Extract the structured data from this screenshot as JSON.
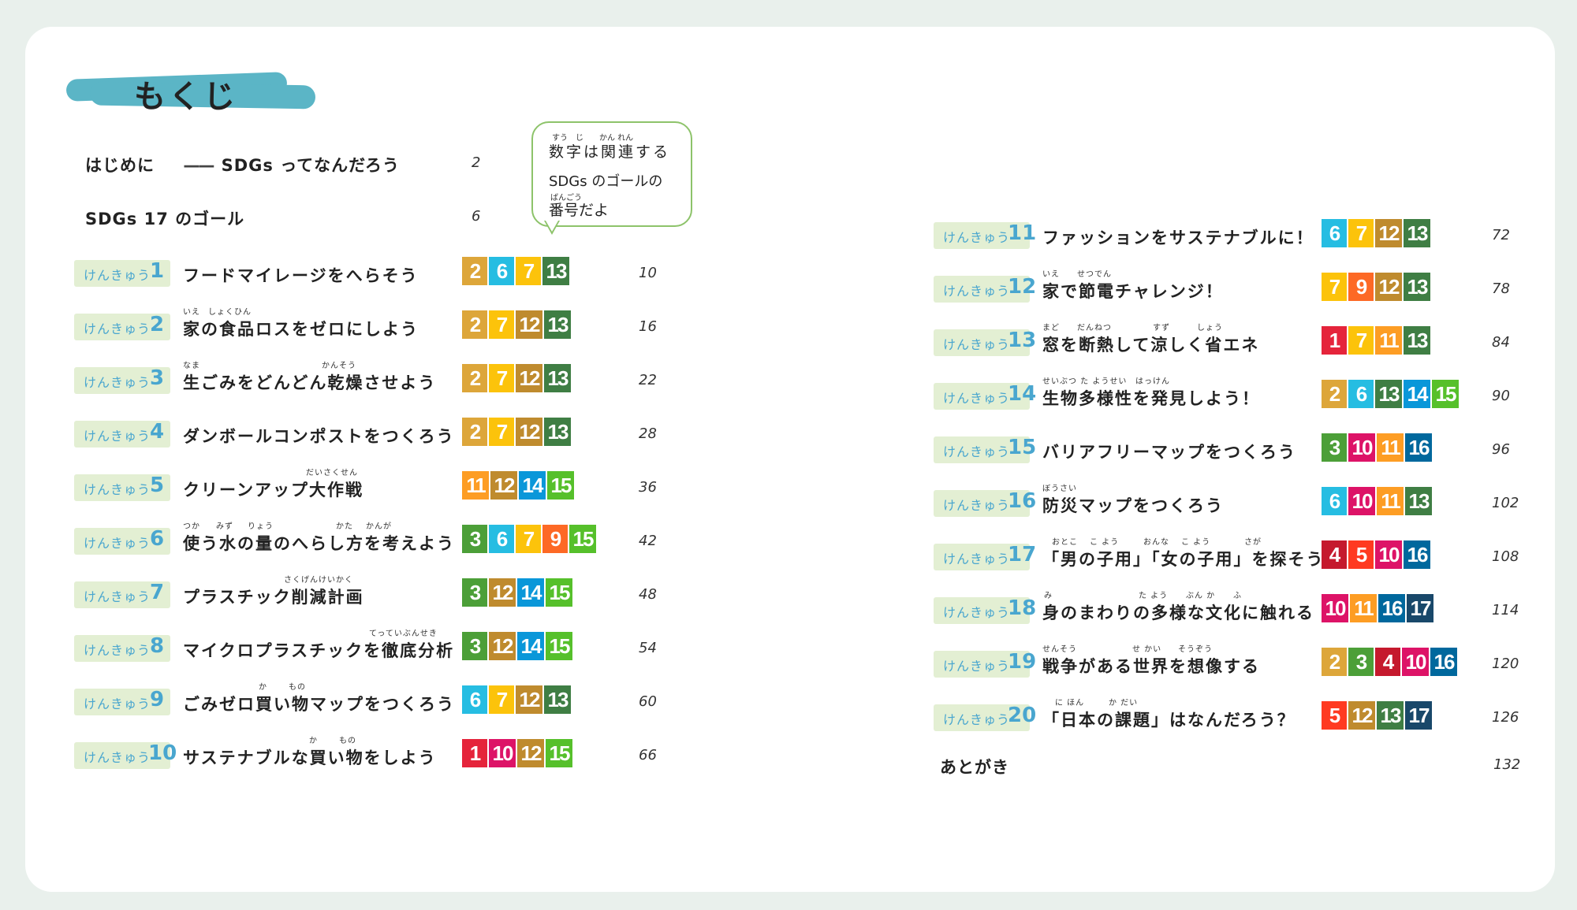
{
  "toc_title": "もくじ",
  "intro": {
    "label": "はじめに",
    "dash": "——",
    "subtitle": "SDGs ってなんだろう",
    "page": "2"
  },
  "goals17": {
    "label": "SDGs 17 のゴール",
    "page": "6"
  },
  "bubble": {
    "line1": "数字は関連する",
    "line1_ruby": "すう　じ　　かん れん",
    "line2": "SDGs のゴールの",
    "line3": "番号だよ",
    "line3_ruby": "ばんごう"
  },
  "kenkyu_label": "けんきゅう",
  "afterword": {
    "label": "あとがき",
    "page": "132"
  },
  "goal_colors": {
    "1": "#e5243b",
    "2": "#dda63a",
    "3": "#4c9f38",
    "4": "#c5192d",
    "5": "#ff3a21",
    "6": "#26bde2",
    "7": "#fcc30b",
    "9": "#fd6925",
    "10": "#dd1367",
    "11": "#fd9d24",
    "12": "#bf8b2e",
    "13": "#3f7e44",
    "14": "#0a97d9",
    "15": "#56c02b",
    "16": "#00689d",
    "17": "#19486a"
  },
  "left_rows": [
    {
      "num": "1",
      "title": "フードマイレージをへらそう",
      "ruby": [],
      "goals": [
        "2",
        "6",
        "7",
        "13"
      ],
      "page": "10"
    },
    {
      "num": "2",
      "title": "家の食品ロスをゼロにしよう",
      "ruby": [
        {
          "text": "いえ",
          "offset": 0
        },
        {
          "text": "しょくひん",
          "offset": 32
        }
      ],
      "goals": [
        "2",
        "7",
        "12",
        "13"
      ],
      "page": "16"
    },
    {
      "num": "3",
      "title": "生ごみをどんどん乾燥させよう",
      "ruby": [
        {
          "text": "なま",
          "offset": 0
        },
        {
          "text": "かんそう",
          "offset": 176
        }
      ],
      "goals": [
        "2",
        "7",
        "12",
        "13"
      ],
      "page": "22"
    },
    {
      "num": "4",
      "title": "ダンボールコンポストをつくろう",
      "ruby": [],
      "goals": [
        "2",
        "7",
        "12",
        "13"
      ],
      "page": "28"
    },
    {
      "num": "5",
      "title": "クリーンアップ大作戦",
      "ruby": [
        {
          "text": "だいさくせん",
          "offset": 156
        }
      ],
      "goals": [
        "11",
        "12",
        "14",
        "15"
      ],
      "page": "36"
    },
    {
      "num": "6",
      "title": "使う水の量のへらし方を考えよう",
      "ruby": [
        {
          "text": "つか",
          "offset": 0
        },
        {
          "text": "みず",
          "offset": 42
        },
        {
          "text": "りょう",
          "offset": 82
        },
        {
          "text": "かた",
          "offset": 194
        },
        {
          "text": "かんが",
          "offset": 232
        }
      ],
      "goals": [
        "3",
        "6",
        "7",
        "9",
        "15"
      ],
      "page": "42"
    },
    {
      "num": "7",
      "title": "プラスチック削減計画",
      "ruby": [
        {
          "text": "さくげんけいかく",
          "offset": 128
        }
      ],
      "goals": [
        "3",
        "12",
        "14",
        "15"
      ],
      "page": "48"
    },
    {
      "num": "8",
      "title": "マイクロプラスチックを徹底分析",
      "ruby": [
        {
          "text": "てっていぶんせき",
          "offset": 236
        }
      ],
      "goals": [
        "3",
        "12",
        "14",
        "15"
      ],
      "page": "54"
    },
    {
      "num": "9",
      "title": "ごみゼロ買い物マップをつくろう",
      "ruby": [
        {
          "text": "か",
          "offset": 96
        },
        {
          "text": "もの",
          "offset": 134
        }
      ],
      "goals": [
        "6",
        "7",
        "12",
        "13"
      ],
      "page": "60"
    },
    {
      "num": "10",
      "title": "サステナブルな買い物をしよう",
      "ruby": [
        {
          "text": "か",
          "offset": 160
        },
        {
          "text": "もの",
          "offset": 198
        }
      ],
      "goals": [
        "1",
        "10",
        "12",
        "15"
      ],
      "page": "66"
    }
  ],
  "right_rows": [
    {
      "num": "11",
      "title": "ファッションをサステナブルに！",
      "ruby": [],
      "goals": [
        "6",
        "7",
        "12",
        "13"
      ],
      "page": "72"
    },
    {
      "num": "12",
      "title": "家で節電チャレンジ！",
      "ruby": [
        {
          "text": "いえ",
          "offset": 0
        },
        {
          "text": "せつでん",
          "offset": 44
        }
      ],
      "goals": [
        "7",
        "9",
        "12",
        "13"
      ],
      "page": "78"
    },
    {
      "num": "13",
      "title": "窓を断熱して涼しく省エネ",
      "ruby": [
        {
          "text": "まど",
          "offset": 0
        },
        {
          "text": "だんねつ",
          "offset": 44
        },
        {
          "text": "すず",
          "offset": 140
        },
        {
          "text": "しょう",
          "offset": 196
        }
      ],
      "goals": [
        "1",
        "7",
        "11",
        "13"
      ],
      "page": "84"
    },
    {
      "num": "14",
      "title": "生物多様性を発見しよう！",
      "ruby": [
        {
          "text": "せいぶつ た ようせい",
          "offset": 0
        },
        {
          "text": "はっけん",
          "offset": 118
        }
      ],
      "goals": [
        "2",
        "6",
        "13",
        "14",
        "15"
      ],
      "page": "90"
    },
    {
      "num": "15",
      "title": "バリアフリーマップをつくろう",
      "ruby": [],
      "goals": [
        "3",
        "10",
        "11",
        "16"
      ],
      "page": "96"
    },
    {
      "num": "16",
      "title": "防災マップをつくろう",
      "ruby": [
        {
          "text": "ぼうさい",
          "offset": 0
        }
      ],
      "goals": [
        "6",
        "10",
        "11",
        "13"
      ],
      "page": "102"
    },
    {
      "num": "17",
      "title": "「男の子用」「女の子用」を探そう",
      "ruby": [
        {
          "text": "おとこ",
          "offset": 12
        },
        {
          "text": "こ よう",
          "offset": 60
        },
        {
          "text": "おんな",
          "offset": 128
        },
        {
          "text": "こ よう",
          "offset": 176
        },
        {
          "text": "さが",
          "offset": 256
        }
      ],
      "goals": [
        "4",
        "5",
        "10",
        "16"
      ],
      "page": "108"
    },
    {
      "num": "18",
      "title": "身のまわりの多様な文化に触れる",
      "ruby": [
        {
          "text": "み",
          "offset": 2
        },
        {
          "text": "た よう",
          "offset": 122
        },
        {
          "text": "ぶん か",
          "offset": 182
        },
        {
          "text": "ふ",
          "offset": 242
        }
      ],
      "goals": [
        "10",
        "11",
        "16",
        "17"
      ],
      "page": "114"
    },
    {
      "num": "19",
      "title": "戦争がある世界を想像する",
      "ruby": [
        {
          "text": "せんそう",
          "offset": 0
        },
        {
          "text": "せ かい",
          "offset": 114
        },
        {
          "text": "そうぞう",
          "offset": 172
        }
      ],
      "goals": [
        "2",
        "3",
        "4",
        "10",
        "16"
      ],
      "page": "120"
    },
    {
      "num": "20",
      "title": "「日本の課題」はなんだろう？",
      "ruby": [
        {
          "text": "に ほん",
          "offset": 16
        },
        {
          "text": "か だい",
          "offset": 84
        }
      ],
      "goals": [
        "5",
        "12",
        "13",
        "17"
      ],
      "page": "126"
    }
  ]
}
